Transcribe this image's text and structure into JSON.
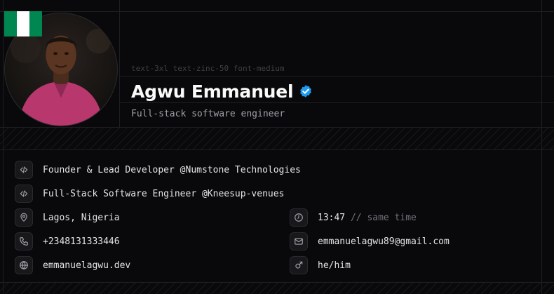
{
  "profile": {
    "name": "Agwu Emmanuel",
    "class_hint": "text-3xl text-zinc-50 font-medium",
    "subtitle": "Full-stack software engineer",
    "verified": true,
    "flag_country": "Nigeria",
    "avatar_alt": "Agwu Emmanuel"
  },
  "info": {
    "job1": {
      "icon": "code-icon",
      "text": "Founder & Lead Developer @Numstone Technologies"
    },
    "job2": {
      "icon": "code-icon",
      "text": "Full-Stack Software Engineer @Kneesup-venues"
    },
    "location": {
      "icon": "map-pin-icon",
      "text": "Lagos, Nigeria"
    },
    "time": {
      "icon": "clock-icon",
      "value": "13:47",
      "note": "// same time"
    },
    "phone": {
      "icon": "phone-icon",
      "text": "+2348131333446"
    },
    "email": {
      "icon": "mail-icon",
      "text": "emmanuelagwu89@gmail.com"
    },
    "website": {
      "icon": "globe-icon",
      "text": "emmanuelagwu.dev"
    },
    "pronouns": {
      "icon": "mars-icon",
      "text": "he/him"
    }
  },
  "colors": {
    "background": "#09090b",
    "verified_badge": "#1d9bf0",
    "flag_green": "#008751"
  }
}
